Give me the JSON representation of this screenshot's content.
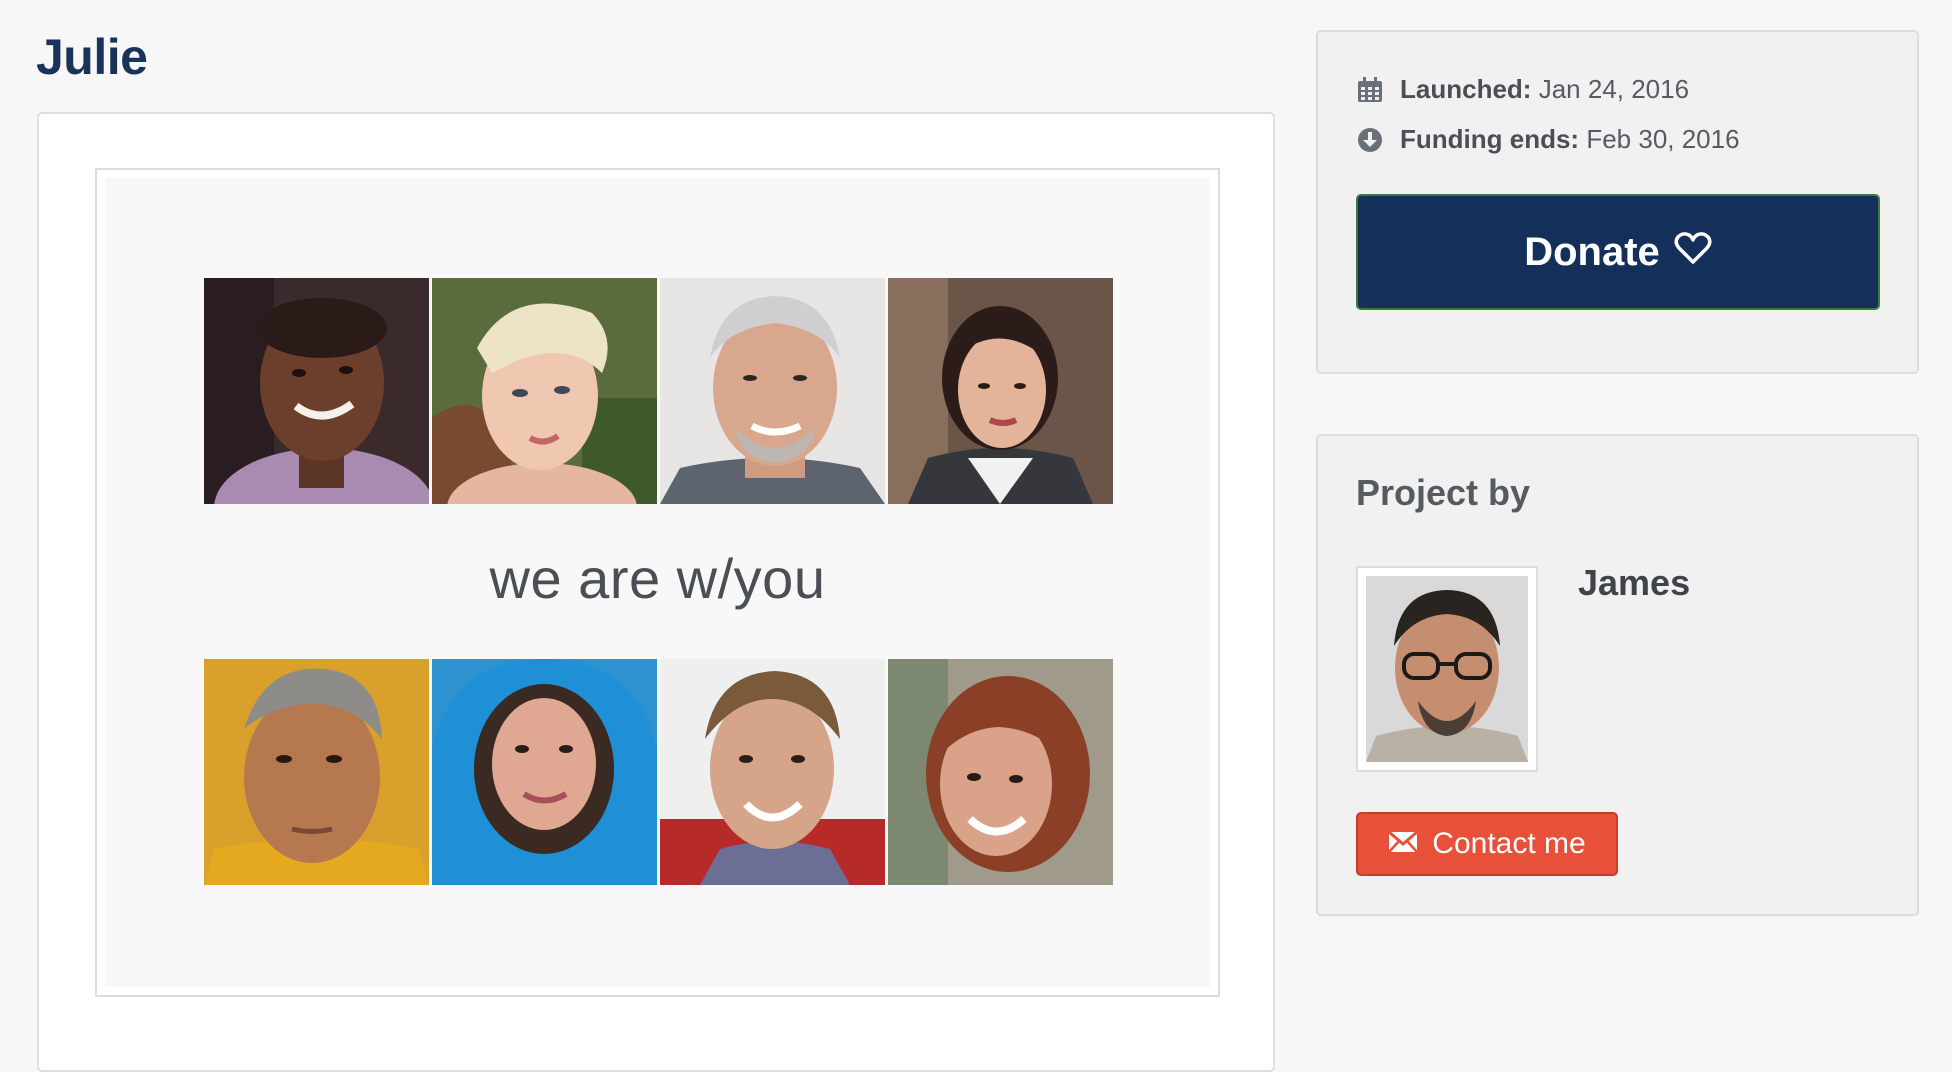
{
  "page": {
    "title": "Julie"
  },
  "campaign": {
    "tagline": "we are w/you",
    "photos_top": [
      "face-1",
      "face-2",
      "face-3",
      "face-4"
    ],
    "photos_bottom": [
      "face-5",
      "face-6",
      "face-7",
      "face-8"
    ]
  },
  "info": {
    "launched_label": "Launched:",
    "launched_value": "Jan 24, 2016",
    "funding_label": "Funding ends:",
    "funding_value": "Feb 30, 2016",
    "launched_icon": "calendar-icon",
    "funding_icon": "download-circle-icon"
  },
  "donate": {
    "label": "Donate",
    "icon": "heart-outline-icon"
  },
  "project": {
    "heading": "Project by",
    "author": "James",
    "contact_label": "Contact me",
    "contact_icon": "envelope-icon"
  },
  "colors": {
    "title": "#1a3358",
    "donate_bg": "#14305a",
    "donate_border": "#3f7a3a",
    "contact_bg": "#e8503a",
    "text_muted": "#555b61"
  }
}
